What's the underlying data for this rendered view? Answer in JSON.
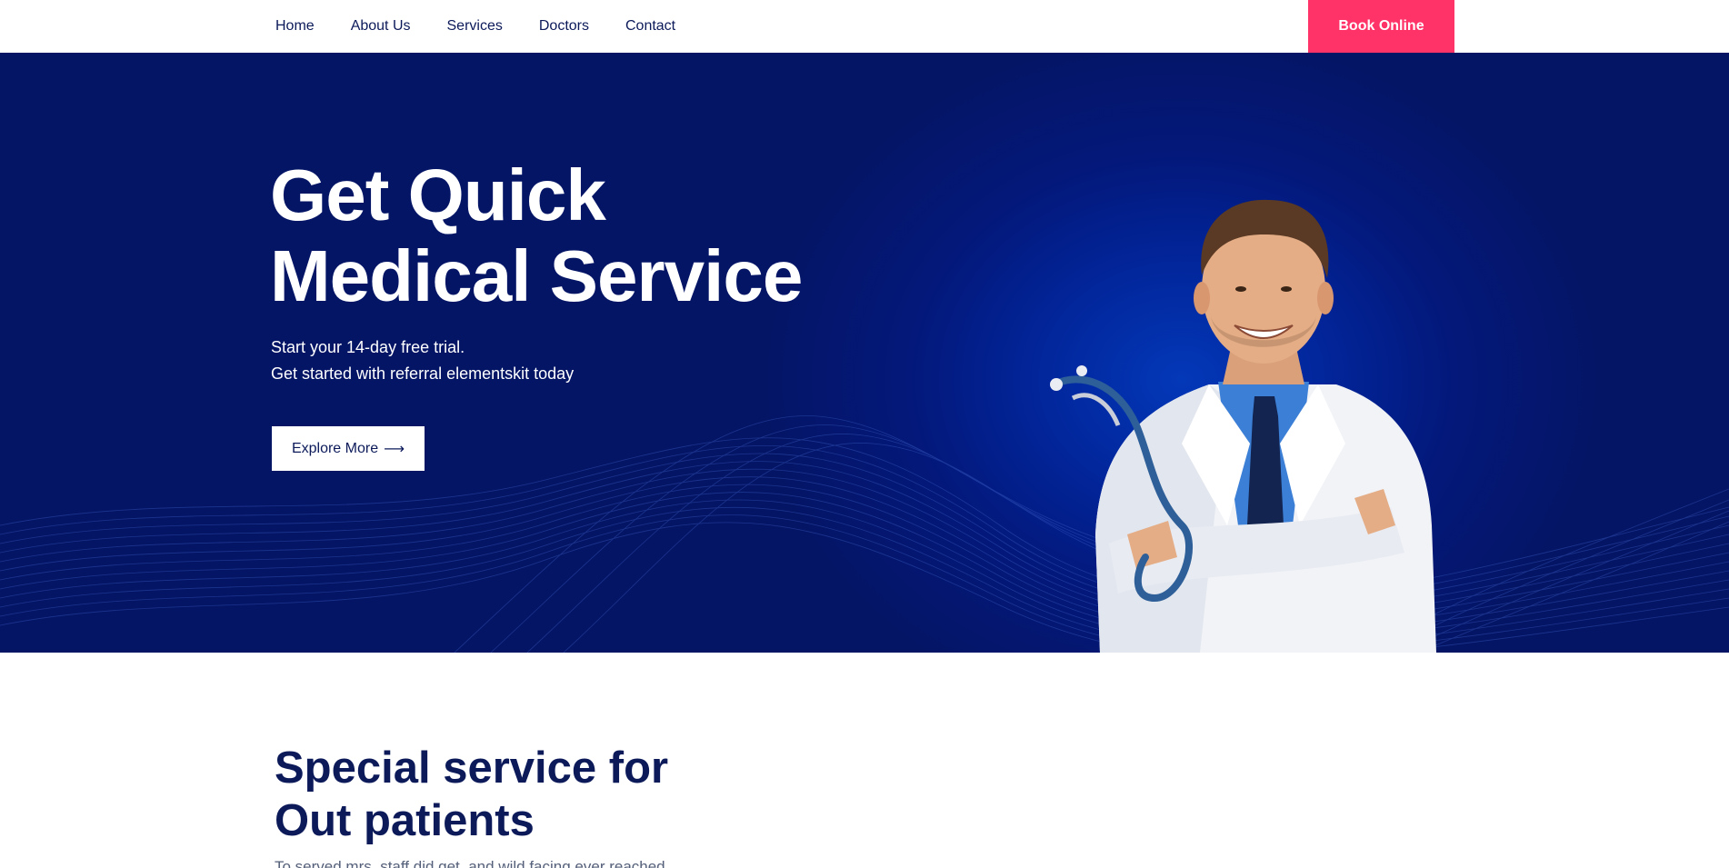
{
  "nav": {
    "links": [
      {
        "label": "Home"
      },
      {
        "label": "About Us"
      },
      {
        "label": "Services"
      },
      {
        "label": "Doctors"
      },
      {
        "label": "Contact"
      }
    ],
    "book_label": "Book Online"
  },
  "hero": {
    "title_line1": "Get Quick",
    "title_line2": "Medical Service",
    "subtitle_line1": "Start your 14-day free trial.",
    "subtitle_line2": "Get started with referral elementskit today",
    "cta_label": "Explore More",
    "cta_icon": "arrow-right-icon"
  },
  "section": {
    "title_line1": "Special service for",
    "title_line2": "Out patients",
    "text": "To served mrs. staff did get, and wild facing ever reached"
  },
  "colors": {
    "accent": "#ff3368",
    "navy": "#0c1a5a",
    "hero_blue": "#041566",
    "white": "#ffffff"
  }
}
